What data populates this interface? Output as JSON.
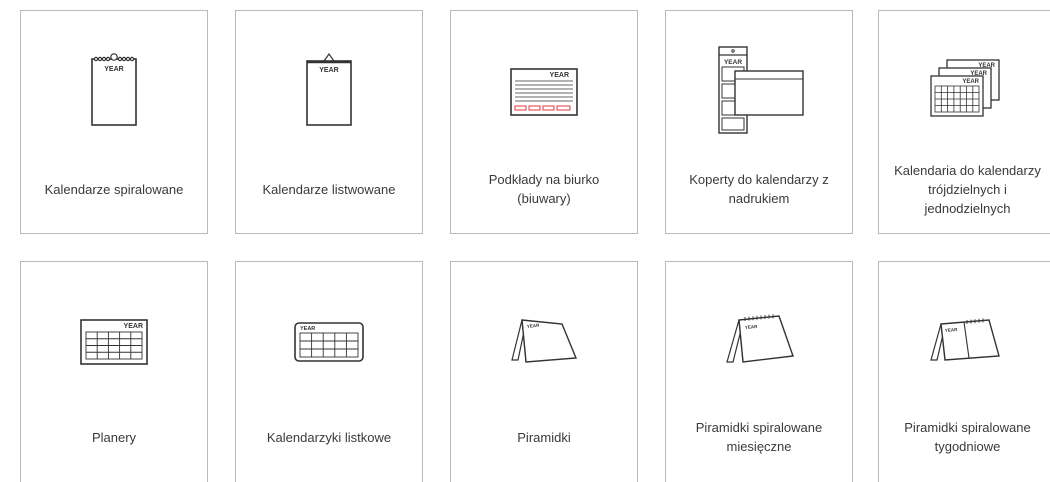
{
  "categories": [
    {
      "label": "Kalendarze spiralowane",
      "icon": "spiral-wall-calendar-icon",
      "icon_text": "YEAR"
    },
    {
      "label": "Kalendarze listwowane",
      "icon": "hanging-wall-calendar-icon",
      "icon_text": "YEAR"
    },
    {
      "label": "Podkłady na biurko (biuwary)",
      "icon": "desk-pad-icon",
      "icon_text": "YEAR"
    },
    {
      "label": "Koperty do kalendarzy z nadrukiem",
      "icon": "calendar-envelope-icon",
      "icon_text": "YEAR"
    },
    {
      "label": "Kalendaria do kalendarzy trójdzielnych i jednodzielnych",
      "icon": "calendar-grids-icon",
      "icon_text": "YEAR"
    },
    {
      "label": "Planery",
      "icon": "planner-icon",
      "icon_text": "YEAR"
    },
    {
      "label": "Kalendarzyki listkowe",
      "icon": "pocket-calendar-icon",
      "icon_text": "YEAR"
    },
    {
      "label": "Piramidki",
      "icon": "tent-calendar-icon",
      "icon_text": "YEAR"
    },
    {
      "label": "Piramidki spiralowane miesięczne",
      "icon": "spiral-tent-monthly-icon",
      "icon_text": "YEAR"
    },
    {
      "label": "Piramidki spiralowane tygodniowe",
      "icon": "spiral-tent-weekly-icon",
      "icon_text": "YEAR"
    }
  ],
  "colors": {
    "border": "#b9b9b9",
    "icon_stroke": "#333333",
    "accent_red": "#e0393e",
    "label": "#3a3a3a"
  }
}
